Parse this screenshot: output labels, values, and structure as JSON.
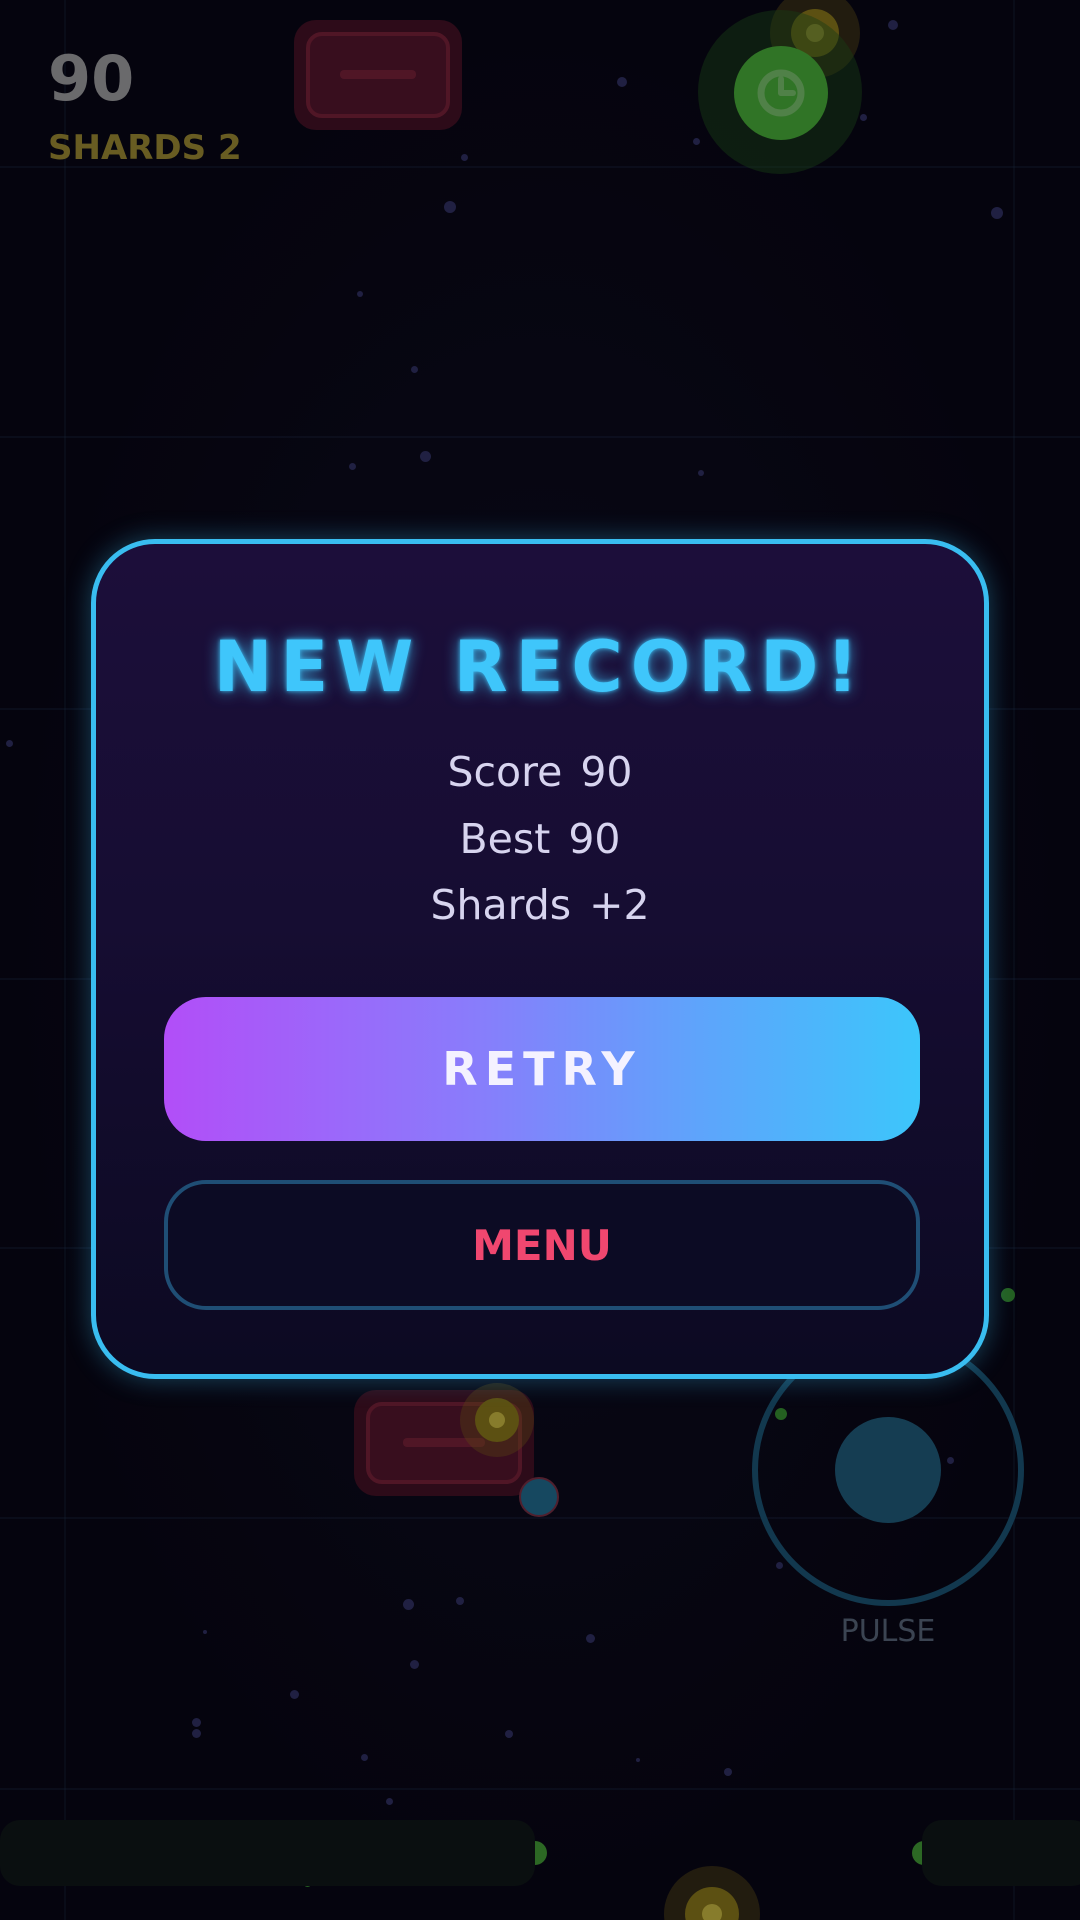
{
  "hud": {
    "score": "90",
    "shards_label": "SHARDS 2"
  },
  "controls": {
    "pulse_label": "PULSE"
  },
  "dialog": {
    "title": "NEW RECORD!",
    "stats": {
      "score_label": "Score",
      "score_value": "90",
      "best_label": "Best",
      "best_value": "90",
      "shards_label": "Shards",
      "shards_value": "+2"
    },
    "retry_label": "RETRY",
    "menu_label": "MENU"
  },
  "colors": {
    "accent_cyan": "#3fc6fb",
    "accent_purple": "#b24ef8",
    "menu_text": "#f0476f",
    "dialog_border": "#39bdf0"
  },
  "icons": {
    "powerup": "clock-icon"
  }
}
